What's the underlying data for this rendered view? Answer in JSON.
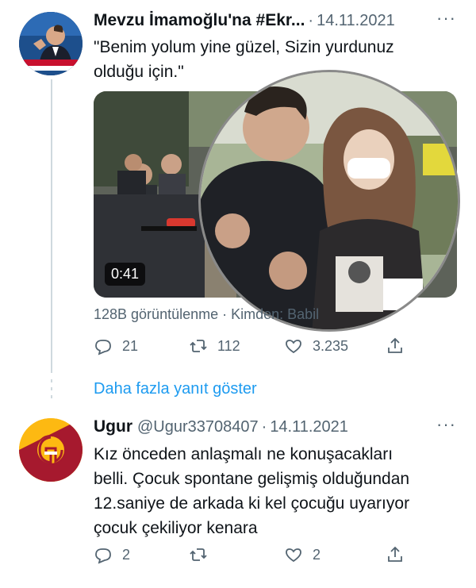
{
  "tweet1": {
    "name": "Mevzu İmamoğlu'na #Ekr...",
    "separator": "·",
    "date": "14.11.2021",
    "more_icon": "more-horizontal-icon",
    "text": "\"Benim yolum yine güzel, Sizin yurdunuz\nolduğu için.\"",
    "video": {
      "duration": "0:41"
    },
    "views": "128B görüntülenme · Kimden: Babil",
    "actions": {
      "reply_count": "21",
      "retweet_count": "112",
      "like_count": "3.235"
    }
  },
  "thread": {
    "show_more_label": "Daha fazla yanıt göster"
  },
  "tweet2": {
    "name": "Ugur",
    "handle": "@Ugur33708407",
    "separator": "·",
    "date": "14.11.2021",
    "text": "Kız önceden anlaşmalı ne konuşacakları\nbelli. Çocuk spontane gelişmiş olduğundan\n12.saniye de arkada ki kel çocuğu uyarıyor\nçocuk çekiliyor kenara",
    "actions": {
      "reply_count": "2",
      "like_count": "2"
    }
  },
  "colors": {
    "link": "#1d9bf0",
    "muted": "#536471",
    "text": "#0f1419",
    "galatasaray_red": "#a6192e",
    "galatasaray_yellow": "#fdb912"
  }
}
